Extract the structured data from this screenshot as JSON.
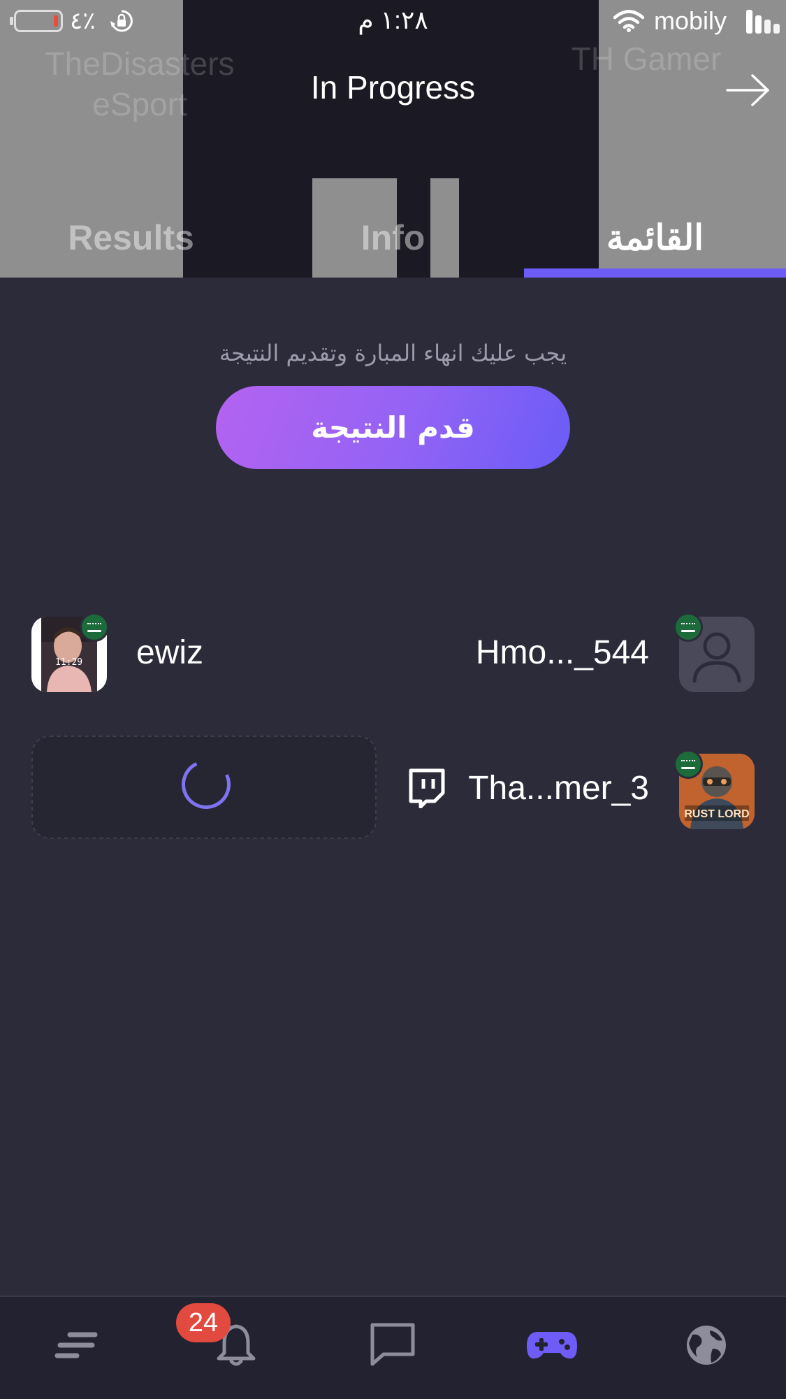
{
  "status_bar": {
    "battery_percent": "٤٪",
    "time": "١:٢٨ م",
    "carrier": "mobily"
  },
  "header": {
    "title": "In Progress",
    "background_team_left": "TheDisasters eSport",
    "background_team_right": "TH Gamer",
    "tabs": [
      {
        "label": "Results",
        "active": false
      },
      {
        "label": "Info",
        "active": false
      },
      {
        "label": "القائمة",
        "active": true
      }
    ]
  },
  "notice": {
    "text": "يجب عليك انهاء المبارة وتقديم النتيجة",
    "submit_button": "قدم النتيجة"
  },
  "players": {
    "left": [
      {
        "name": "ewiz",
        "country": "SA"
      }
    ],
    "right": [
      {
        "name": "Hmo..._544",
        "country": "SA"
      },
      {
        "name": "Tha...mer_3",
        "country": "SA",
        "avatar_text": "RUST LORD",
        "streaming": "twitch"
      }
    ]
  },
  "bottom_nav": {
    "items": [
      {
        "icon": "menu-icon",
        "active": false
      },
      {
        "icon": "bell-icon",
        "active": false,
        "badge": "24"
      },
      {
        "icon": "chat-icon",
        "active": false
      },
      {
        "icon": "gamepad-icon",
        "active": true
      },
      {
        "icon": "globe-icon",
        "active": false
      }
    ]
  },
  "colors": {
    "background": "#2c2b3a",
    "accent": "#6e5cf6",
    "button_gradient_start": "#b463f0",
    "button_gradient_end": "#6a5cf6",
    "badge": "#e24a3f"
  }
}
